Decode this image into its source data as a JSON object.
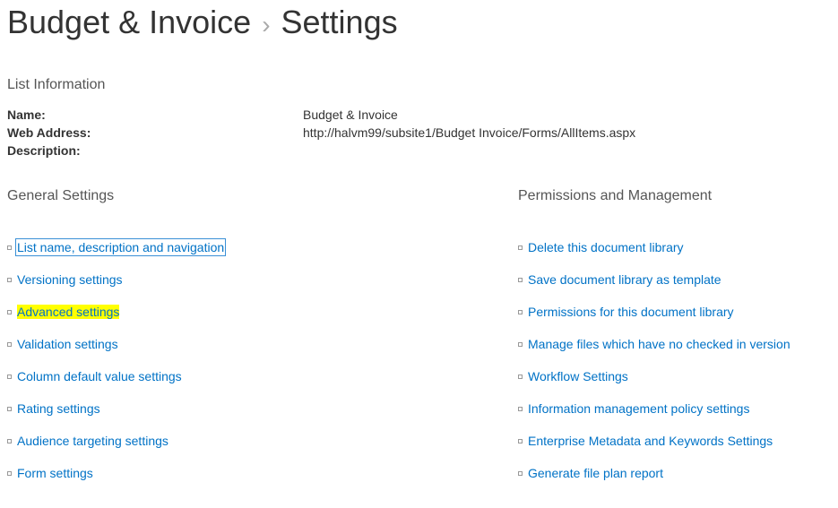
{
  "header": {
    "library_name": "Budget & Invoice",
    "separator": "›",
    "page_name": "Settings"
  },
  "list_info": {
    "heading": "List Information",
    "rows": [
      {
        "label": "Name:",
        "value": "Budget & Invoice"
      },
      {
        "label": "Web Address:",
        "value": "http://halvm99/subsite1/Budget Invoice/Forms/AllItems.aspx"
      },
      {
        "label": "Description:",
        "value": ""
      }
    ]
  },
  "general_settings": {
    "heading": "General Settings",
    "links": [
      {
        "label": "List name, description and navigation",
        "selected": true,
        "highlighted": false
      },
      {
        "label": "Versioning settings",
        "selected": false,
        "highlighted": false
      },
      {
        "label": "Advanced settings",
        "selected": false,
        "highlighted": true
      },
      {
        "label": "Validation settings",
        "selected": false,
        "highlighted": false
      },
      {
        "label": "Column default value settings",
        "selected": false,
        "highlighted": false
      },
      {
        "label": "Rating settings",
        "selected": false,
        "highlighted": false
      },
      {
        "label": "Audience targeting settings",
        "selected": false,
        "highlighted": false
      },
      {
        "label": "Form settings",
        "selected": false,
        "highlighted": false
      }
    ]
  },
  "permissions_management": {
    "heading": "Permissions and Management",
    "links": [
      {
        "label": "Delete this document library"
      },
      {
        "label": "Save document library as template"
      },
      {
        "label": "Permissions for this document library"
      },
      {
        "label": "Manage files which have no checked in version"
      },
      {
        "label": "Workflow Settings"
      },
      {
        "label": "Information management policy settings"
      },
      {
        "label": "Enterprise Metadata and Keywords Settings"
      },
      {
        "label": "Generate file plan report"
      }
    ]
  }
}
